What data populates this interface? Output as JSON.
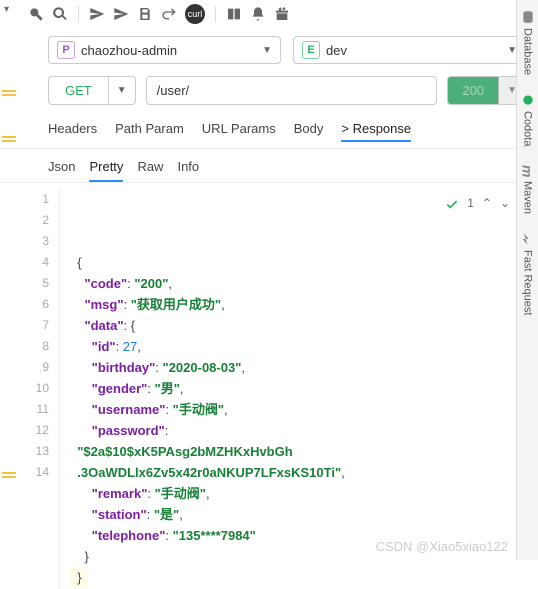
{
  "toolbar": {
    "caret": "▾",
    "icons": [
      "wrench",
      "search",
      "send-fill",
      "send-outline",
      "save",
      "redo",
      "curl",
      "book",
      "bell",
      "gift"
    ]
  },
  "project_dd": {
    "badge": "P",
    "label": "chaozhou-admin"
  },
  "env_dd": {
    "badge": "E",
    "label": "dev"
  },
  "request": {
    "method": "GET",
    "url": "/user/",
    "status": "200"
  },
  "tabs_main": [
    "Headers",
    "Path Param",
    "URL Params",
    "Body",
    "> Response"
  ],
  "tabs_main_active": 4,
  "tabs_resp": [
    "Json",
    "Pretty",
    "Raw",
    "Info"
  ],
  "tabs_resp_active": 1,
  "marks": {
    "check": "✓",
    "count": "1",
    "up": "⌃",
    "down": "⌄"
  },
  "side_tabs": [
    "Database",
    "Codota",
    "Maven",
    "Fast Request"
  ],
  "watermark": "CSDN @Xiao5xiao122",
  "json_lines": [
    {
      "n": 1,
      "ind": 0,
      "parts": [
        {
          "t": "{",
          "c": "p"
        }
      ]
    },
    {
      "n": 2,
      "ind": 1,
      "parts": [
        {
          "t": "\"code\"",
          "c": "k"
        },
        {
          "t": ": ",
          "c": "p"
        },
        {
          "t": "\"200\"",
          "c": "s"
        },
        {
          "t": ",",
          "c": "p"
        }
      ]
    },
    {
      "n": 3,
      "ind": 1,
      "parts": [
        {
          "t": "\"msg\"",
          "c": "k"
        },
        {
          "t": ": ",
          "c": "p"
        },
        {
          "t": "\"获取用户成功\"",
          "c": "s"
        },
        {
          "t": ",",
          "c": "p"
        }
      ]
    },
    {
      "n": 4,
      "ind": 1,
      "parts": [
        {
          "t": "\"data\"",
          "c": "k"
        },
        {
          "t": ": {",
          "c": "p"
        }
      ]
    },
    {
      "n": 5,
      "ind": 2,
      "parts": [
        {
          "t": "\"id\"",
          "c": "k"
        },
        {
          "t": ": ",
          "c": "p"
        },
        {
          "t": "27",
          "c": "n"
        },
        {
          "t": ",",
          "c": "p"
        }
      ]
    },
    {
      "n": 6,
      "ind": 2,
      "parts": [
        {
          "t": "\"birthday\"",
          "c": "k"
        },
        {
          "t": ": ",
          "c": "p"
        },
        {
          "t": "\"2020-08-03\"",
          "c": "s"
        },
        {
          "t": ",",
          "c": "p"
        }
      ]
    },
    {
      "n": 7,
      "ind": 2,
      "parts": [
        {
          "t": "\"gender\"",
          "c": "k"
        },
        {
          "t": ": ",
          "c": "p"
        },
        {
          "t": "\"男\"",
          "c": "s"
        },
        {
          "t": ",",
          "c": "p"
        }
      ]
    },
    {
      "n": 8,
      "ind": 2,
      "parts": [
        {
          "t": "\"username\"",
          "c": "k"
        },
        {
          "t": ": ",
          "c": "p"
        },
        {
          "t": "\"手动阀\"",
          "c": "s"
        },
        {
          "t": ",",
          "c": "p"
        }
      ]
    },
    {
      "n": 9,
      "ind": 2,
      "parts": [
        {
          "t": "\"password\"",
          "c": "k"
        },
        {
          "t": ":",
          "c": "p"
        }
      ]
    },
    {
      "n": "",
      "ind": 0,
      "parts": [
        {
          "t": "\"$2a$10$xK5PAsg2bMZHKxHvbGh",
          "c": "s"
        }
      ]
    },
    {
      "n": "",
      "ind": 0,
      "parts": [
        {
          "t": ".3OaWDLlx6Zv5x42r0aNKUP7LFxsKS10Ti\"",
          "c": "s"
        },
        {
          "t": ",",
          "c": "p"
        }
      ]
    },
    {
      "n": 10,
      "ind": 2,
      "parts": [
        {
          "t": "\"remark\"",
          "c": "k"
        },
        {
          "t": ": ",
          "c": "p"
        },
        {
          "t": "\"手动阀\"",
          "c": "s"
        },
        {
          "t": ",",
          "c": "p"
        }
      ]
    },
    {
      "n": 11,
      "ind": 2,
      "parts": [
        {
          "t": "\"station\"",
          "c": "k"
        },
        {
          "t": ": ",
          "c": "p"
        },
        {
          "t": "\"是\"",
          "c": "s"
        },
        {
          "t": ",",
          "c": "p"
        }
      ]
    },
    {
      "n": 12,
      "ind": 2,
      "parts": [
        {
          "t": "\"telephone\"",
          "c": "k"
        },
        {
          "t": ": ",
          "c": "p"
        },
        {
          "t": "\"135****7984\"",
          "c": "s"
        }
      ]
    },
    {
      "n": 13,
      "ind": 1,
      "parts": [
        {
          "t": "}",
          "c": "p"
        }
      ]
    },
    {
      "n": 14,
      "ind": 0,
      "parts": [
        {
          "t": "}",
          "c": "p"
        }
      ],
      "hl": true
    }
  ]
}
